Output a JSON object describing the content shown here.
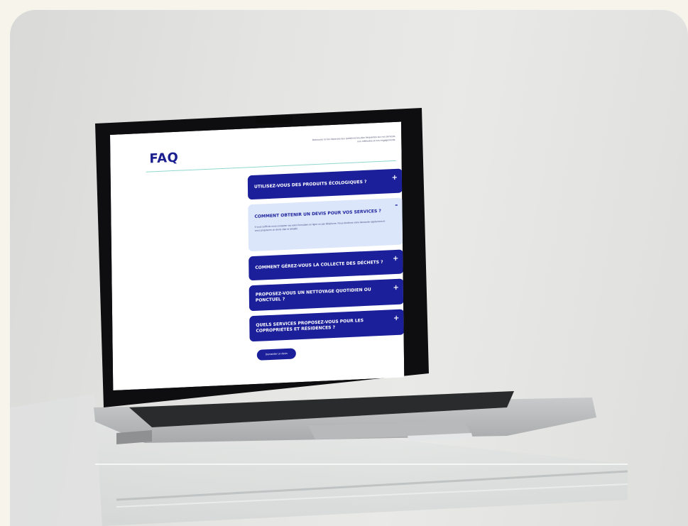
{
  "faq": {
    "title": "FAQ",
    "intro": "Retrouvez ici les réponses aux questions les plus fréquentes sur nos services, nos méthodes et nos engagements.",
    "items": [
      {
        "question": "Utilisez-vous des produits écologiques ?",
        "toggle": "+"
      },
      {
        "question": "Comment obtenir un devis pour vos services ?",
        "toggle": "-",
        "answer": "Il vous suffit de nous contacter via notre formulaire en ligne ou par téléphone. Nous étudions votre demande rapidement et vous proposons un devis clair et détaillé."
      },
      {
        "question": "Comment gérez-vous la collecte des déchets ?",
        "toggle": "+"
      },
      {
        "question": "Proposez-vous un nettoyage quotidien ou ponctuel ?",
        "toggle": "+"
      },
      {
        "question": "Quels services proposez-vous pour les copropriétés et résidences ?",
        "toggle": "+"
      }
    ],
    "cta_label": "Demander un devis"
  },
  "colors": {
    "brand_navy": "#1b1f9a",
    "accent_light_blue": "#dbe6fb",
    "divider_teal": "#8fd8cf",
    "page_background": "#f7f4ec"
  }
}
